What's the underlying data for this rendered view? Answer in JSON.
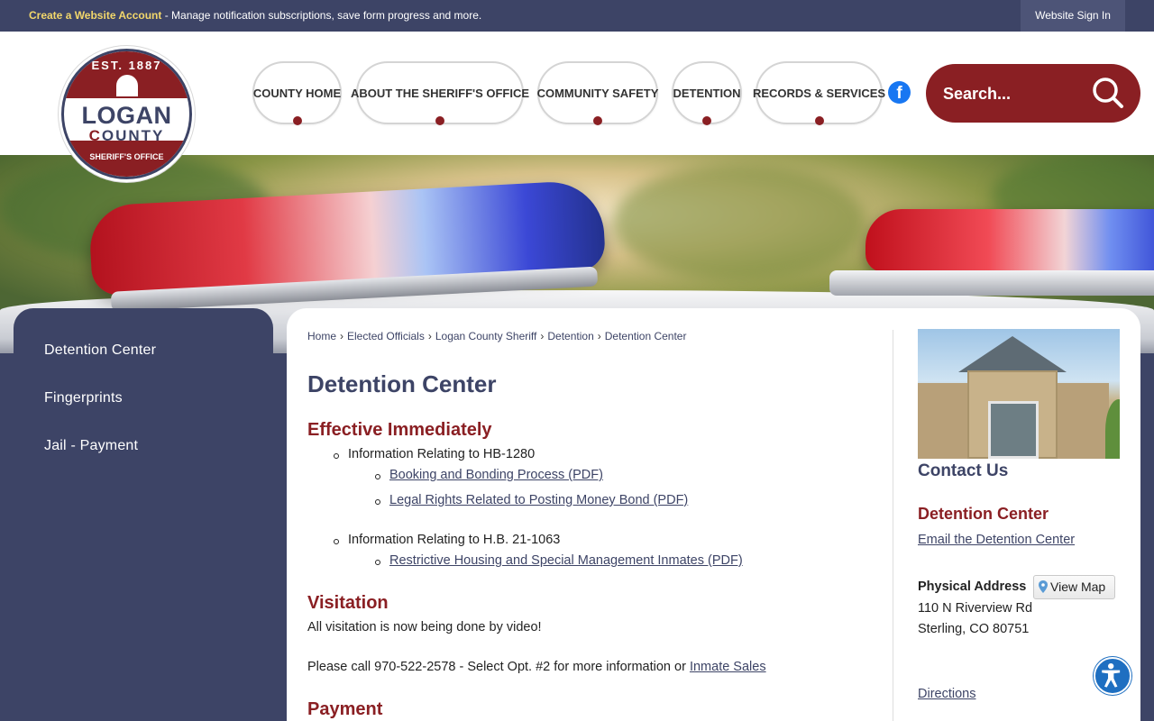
{
  "topbar": {
    "account_link": "Create a Website Account",
    "message": " - Manage notification subscriptions, save form progress and more.",
    "signin": "Website Sign In"
  },
  "logo": {
    "est": "EST. 1887",
    "logan": "LOGAN",
    "county_c": "C",
    "county_rest": "OUNTY",
    "office": "SHERIFF'S OFFICE"
  },
  "nav": {
    "items": [
      {
        "label": "County Home"
      },
      {
        "label": "About the Sheriff's Office"
      },
      {
        "label": "Community Safety"
      },
      {
        "label": "Detention"
      },
      {
        "label": "Records & Services"
      }
    ]
  },
  "social": {
    "facebook_icon": "facebook-icon",
    "facebook_glyph": "f"
  },
  "search": {
    "placeholder": "Search...",
    "icon": "search-icon"
  },
  "sidebar": {
    "items": [
      {
        "label": "Detention Center"
      },
      {
        "label": "Fingerprints"
      },
      {
        "label": "Jail - Payment"
      }
    ]
  },
  "breadcrumb": {
    "items": [
      "Home",
      "Elected Officials",
      "Logan County Sheriff",
      "Detention",
      "Detention Center"
    ],
    "separator": "›"
  },
  "main": {
    "title": "Detention Center",
    "effective": {
      "heading": "Effective Immediately",
      "item1": "Information Relating to HB-1280",
      "item1_links": [
        "Booking and Bonding Process (PDF)",
        "Legal Rights Related to Posting Money Bond (PDF)"
      ],
      "item2": "Information Relating to H.B. 21-1063",
      "item2_links": [
        "Restrictive Housing and Special Management Inmates (PDF)"
      ]
    },
    "visitation": {
      "heading": "Visitation",
      "line1": "All visitation is now being done by video!",
      "line2": "Please call 970-522-2578 - Select Opt. #2 for more information or ",
      "link": "Inmate Sales"
    },
    "payment": {
      "heading": "Payment"
    }
  },
  "contact": {
    "heading": "Contact Us",
    "name": "Detention Center",
    "email_link": "Email the Detention Center",
    "address_label": "Physical Address",
    "view_map": "View Map",
    "address1": "110 N Riverview Rd",
    "address2": "Sterling, CO 80751",
    "directions": "Directions"
  },
  "colors": {
    "primary": "#3d4466",
    "accent": "#8a1f23",
    "highlight": "#f2d76b"
  }
}
